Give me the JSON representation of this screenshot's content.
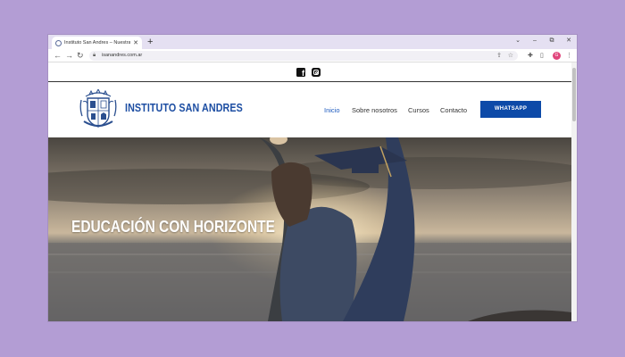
{
  "browser": {
    "tab_title": "Instituto San Andres – Nuestra Ins",
    "tab_close": "✕",
    "new_tab": "+",
    "url": "isanandres.com.ar",
    "controls": {
      "minimize": "–",
      "restore": "⧉",
      "close": "✕",
      "tab_search": "⌄"
    },
    "nav": {
      "back": "←",
      "forward": "→",
      "reload": "↻"
    },
    "profile_initial": "G"
  },
  "site": {
    "social": {
      "facebook_icon": "facebook-icon",
      "instagram_icon": "instagram-icon"
    },
    "brand": "INSTITUTO SAN ANDRES",
    "menu": [
      "Inicio",
      "Sobre nosotros",
      "Cursos",
      "Contacto"
    ],
    "cta": "WHATSAPP",
    "hero_title": "EDUCACIÓN CON HORIZONTE"
  },
  "colors": {
    "background": "#b39dd4",
    "brand_blue": "#1e4fa3",
    "cta_blue": "#0d4aa8",
    "menu_active": "#1e5bbf"
  }
}
